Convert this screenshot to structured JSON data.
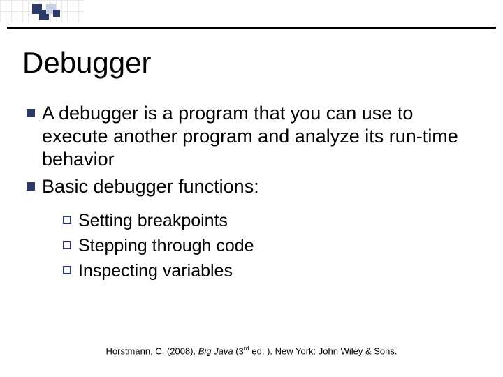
{
  "title": "Debugger",
  "bullets": [
    "A debugger is a program that you can use to execute another program and analyze its run-time behavior",
    "Basic debugger functions:"
  ],
  "subbullets": [
    "Setting breakpoints",
    "Stepping through code",
    "Inspecting variables"
  ],
  "citation": {
    "author": "Horstmann, C. (2008). ",
    "title_italic": "Big Java ",
    "edition": "(3",
    "edition_sup": "rd",
    "edition_tail": " ed. ). New York: John Wiley & Sons."
  }
}
